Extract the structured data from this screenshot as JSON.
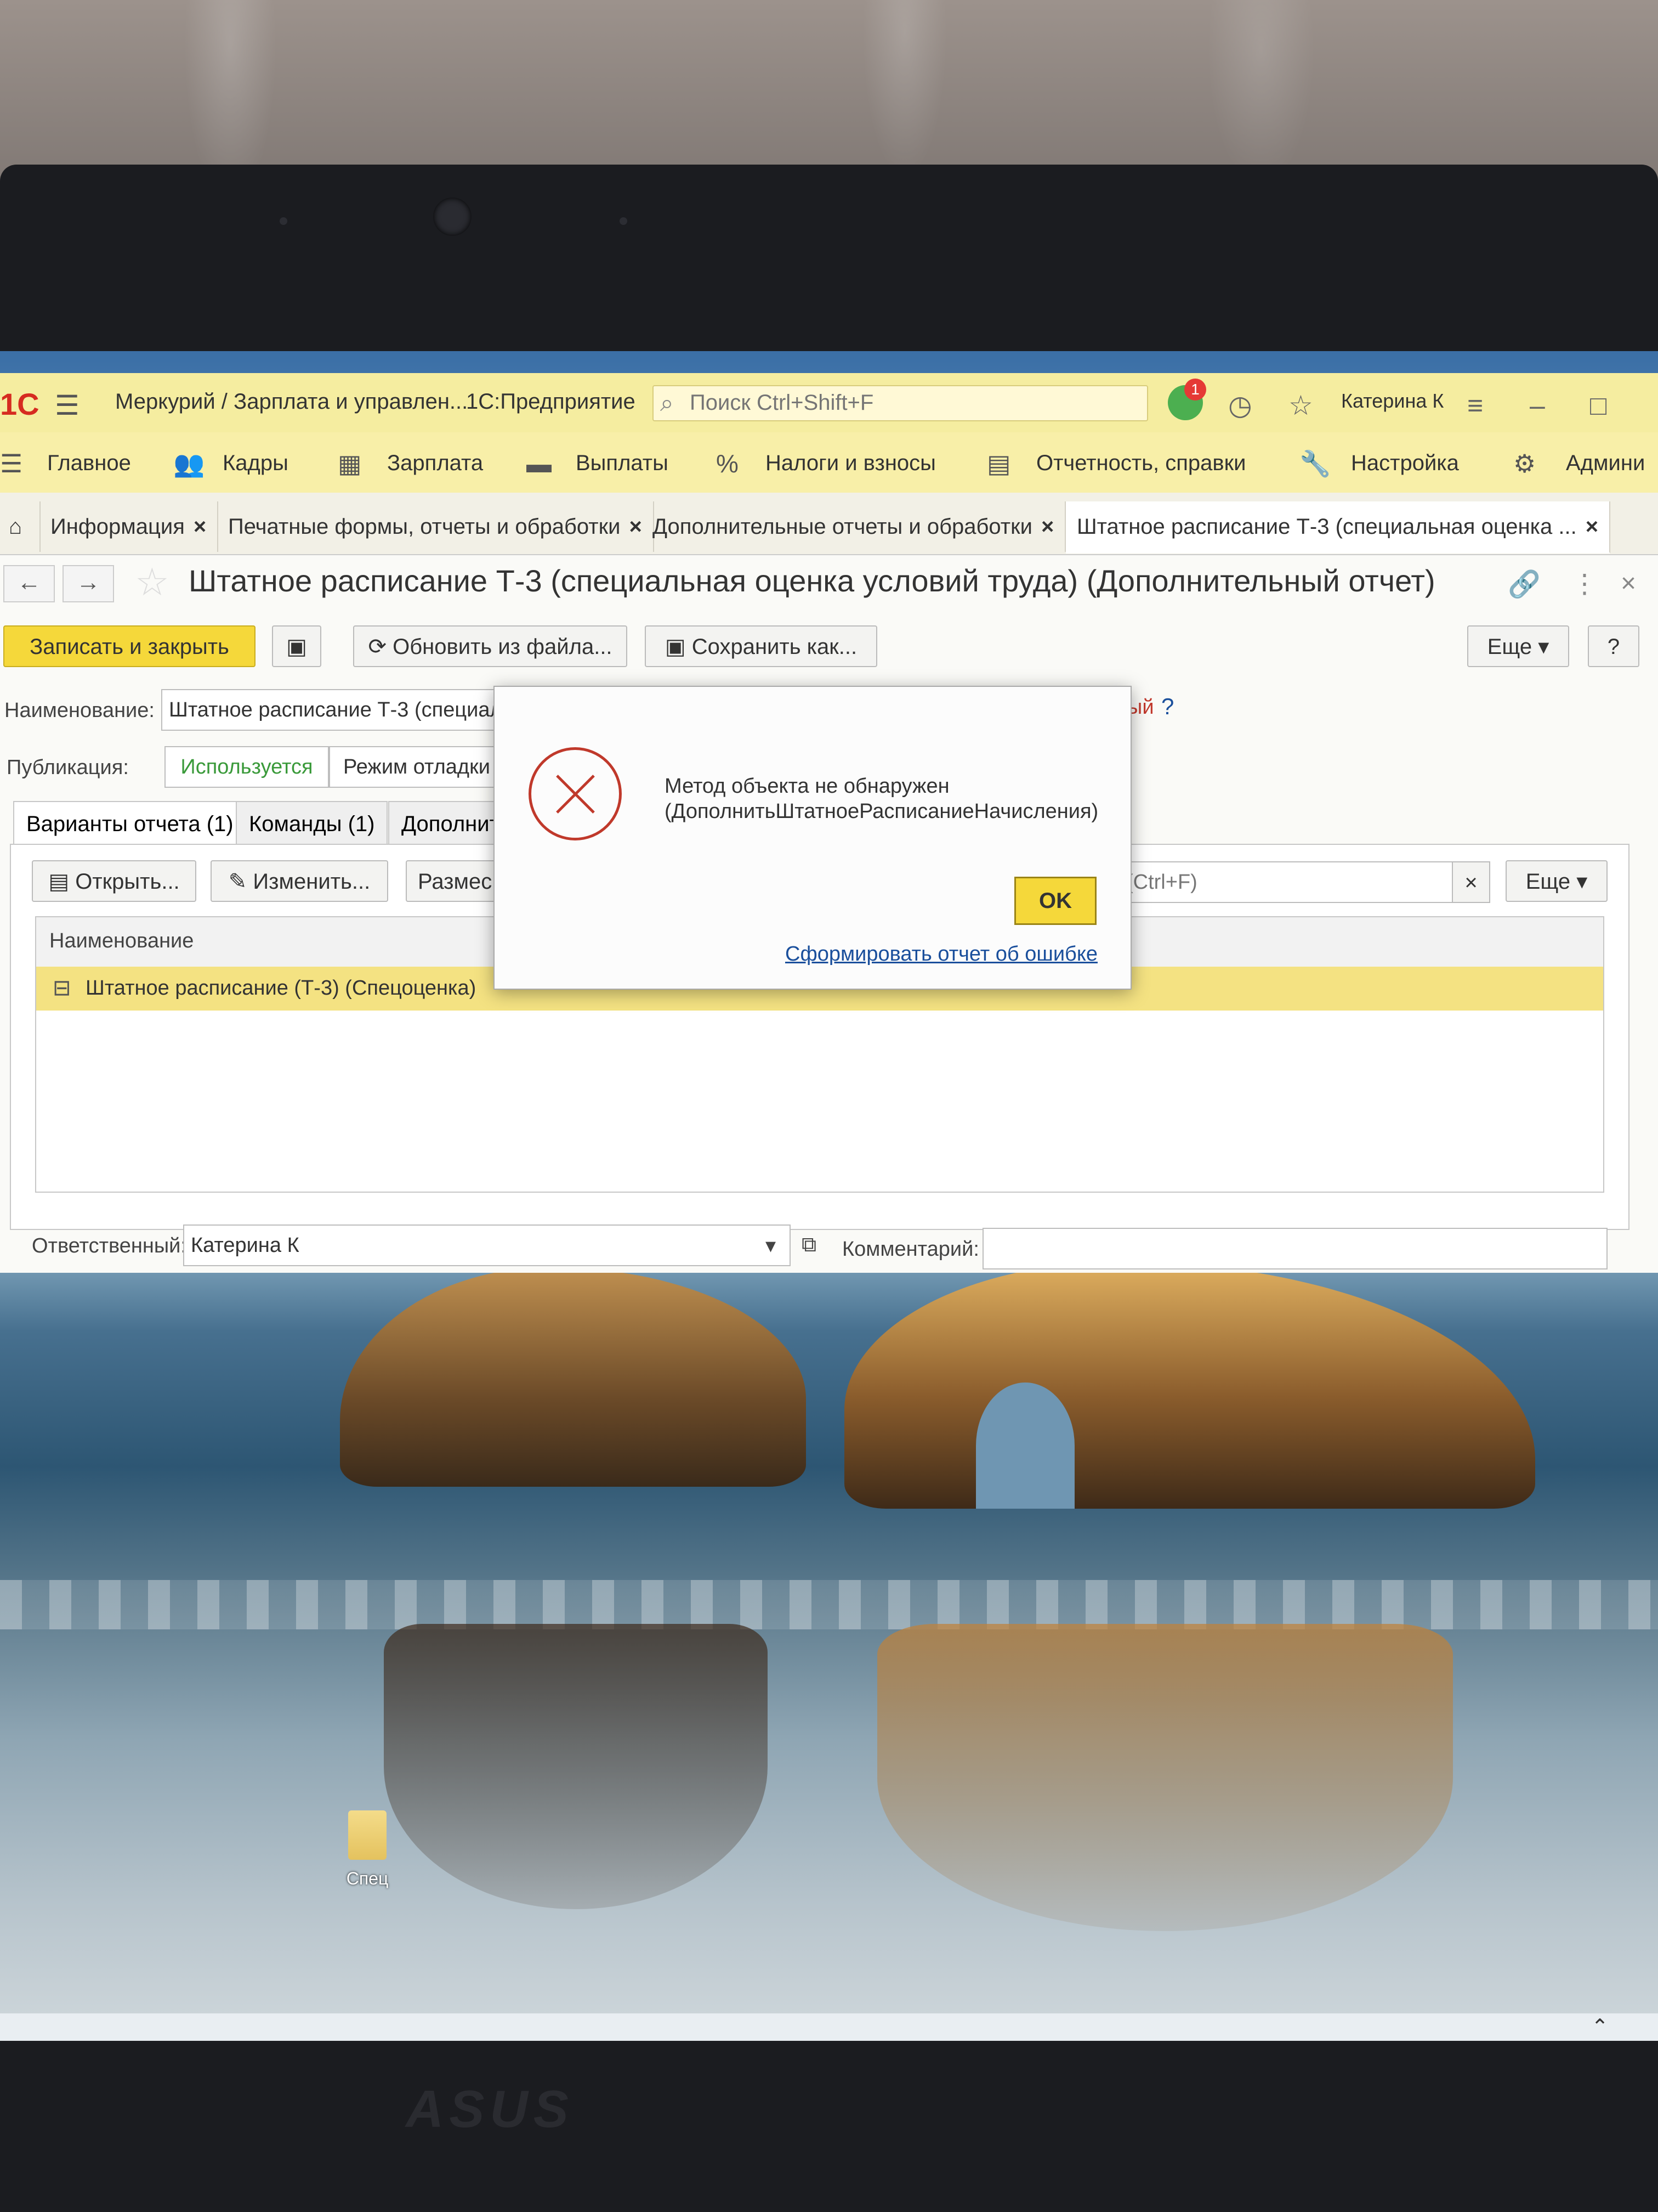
{
  "titlebar": {
    "logo": "1С",
    "app_path": "Меркурий / Зарплата и управлен...",
    "app_name": "1С:Предприятие",
    "search_placeholder": "Поиск Ctrl+Shift+F",
    "notifications_count": "1",
    "user": "Катерина К"
  },
  "menu": {
    "items": [
      "Главное",
      "Кадры",
      "Зарплата",
      "Выплаты",
      "Налоги и взносы",
      "Отчетность, справки",
      "Настройка",
      "Админи"
    ]
  },
  "tabs": {
    "items": [
      "Информация",
      "Печатные формы, отчеты и обработки",
      "Дополнительные отчеты и обработки",
      "Штатное расписание Т-3 (специальная оценка ..."
    ]
  },
  "form": {
    "title": "Штатное расписание Т-3 (специальная оценка условий труда) (Дополнительный отчет)",
    "save_close": "Записать и закрыть",
    "update_from_file": "Обновить из файла...",
    "save_as": "Сохранить как...",
    "more": "Еще",
    "help": "?",
    "name_label": "Наименование:",
    "name_value": "Штатное расписание Т-3 (специал",
    "name_suffix": "ый",
    "name_help": "?",
    "pub_label": "Публикация:",
    "pub_used": "Используется",
    "pub_debug": "Режим отладки",
    "inner_tabs": [
      "Варианты отчета (1)",
      "Команды (1)",
      "Дополнит"
    ],
    "open": "Открыть...",
    "edit": "Изменить...",
    "place": "Размес",
    "search_hint": "(Ctrl+F)",
    "clear": "×",
    "more2": "Еще",
    "col_name": "Наименование",
    "row_value": "Штатное расписание (Т-3) (Спецоценка)",
    "resp_label": "Ответственный:",
    "resp_value": "Катерина К",
    "comment_label": "Комментарий:"
  },
  "dialog": {
    "message_line1": "Метод объекта не обнаружен",
    "message_line2": "(ДополнитьШтатноеРасписаниеНачисления)",
    "ok": "OK",
    "report_link": "Сформировать отчет об ошибке"
  },
  "desktop": {
    "icon_label": "Спец",
    "brand": "ASUS"
  }
}
